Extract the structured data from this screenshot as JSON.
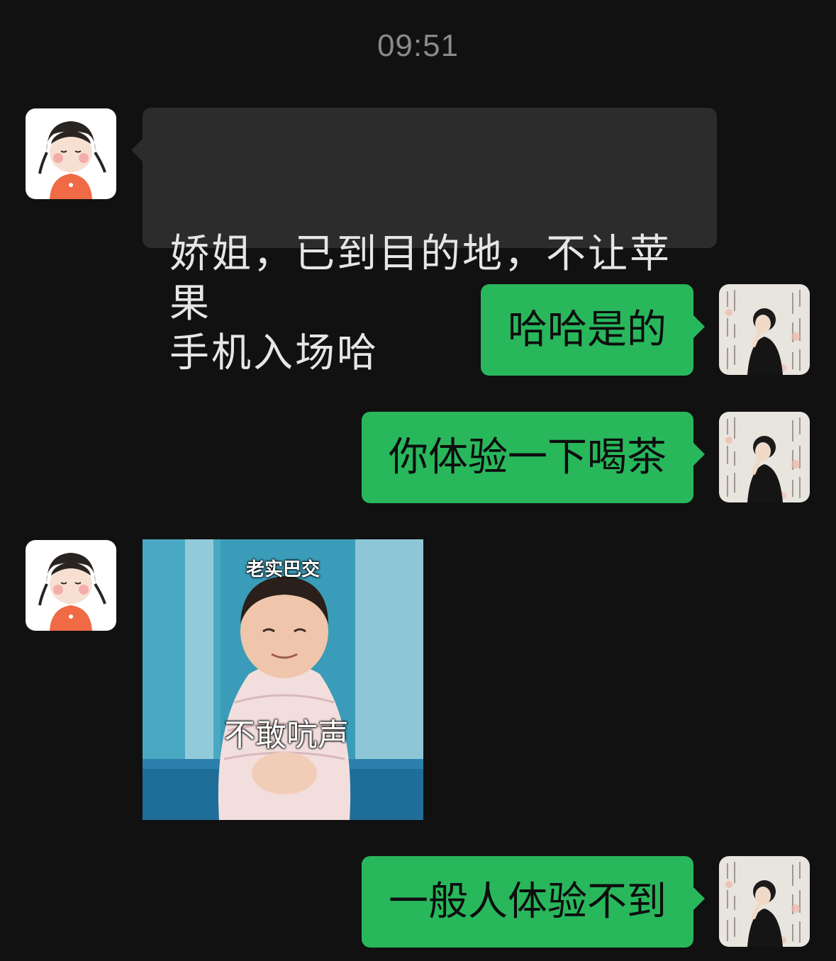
{
  "chat": {
    "timestamp": "09:51",
    "messages": [
      {
        "direction": "incoming",
        "type": "text",
        "text": "娇姐，已到目的地，不让苹果\n手机入场哈"
      },
      {
        "direction": "outgoing",
        "type": "text",
        "text": "哈哈是的"
      },
      {
        "direction": "outgoing",
        "type": "text",
        "text": "你体验一下喝茶"
      },
      {
        "direction": "incoming",
        "type": "sticker",
        "caption_top": "老实巴交",
        "caption_main": "不敢吭声"
      },
      {
        "direction": "outgoing",
        "type": "text",
        "text": "一般人体验不到"
      }
    ]
  },
  "icons": {
    "incoming_avatar": "cartoon-girl-avatar",
    "outgoing_avatar": "woman-calligraphy-avatar"
  },
  "colors": {
    "background": "#111111",
    "incoming_bubble": "#2c2c2c",
    "outgoing_bubble": "#29b75c",
    "timestamp_text": "#8a8a8a"
  }
}
